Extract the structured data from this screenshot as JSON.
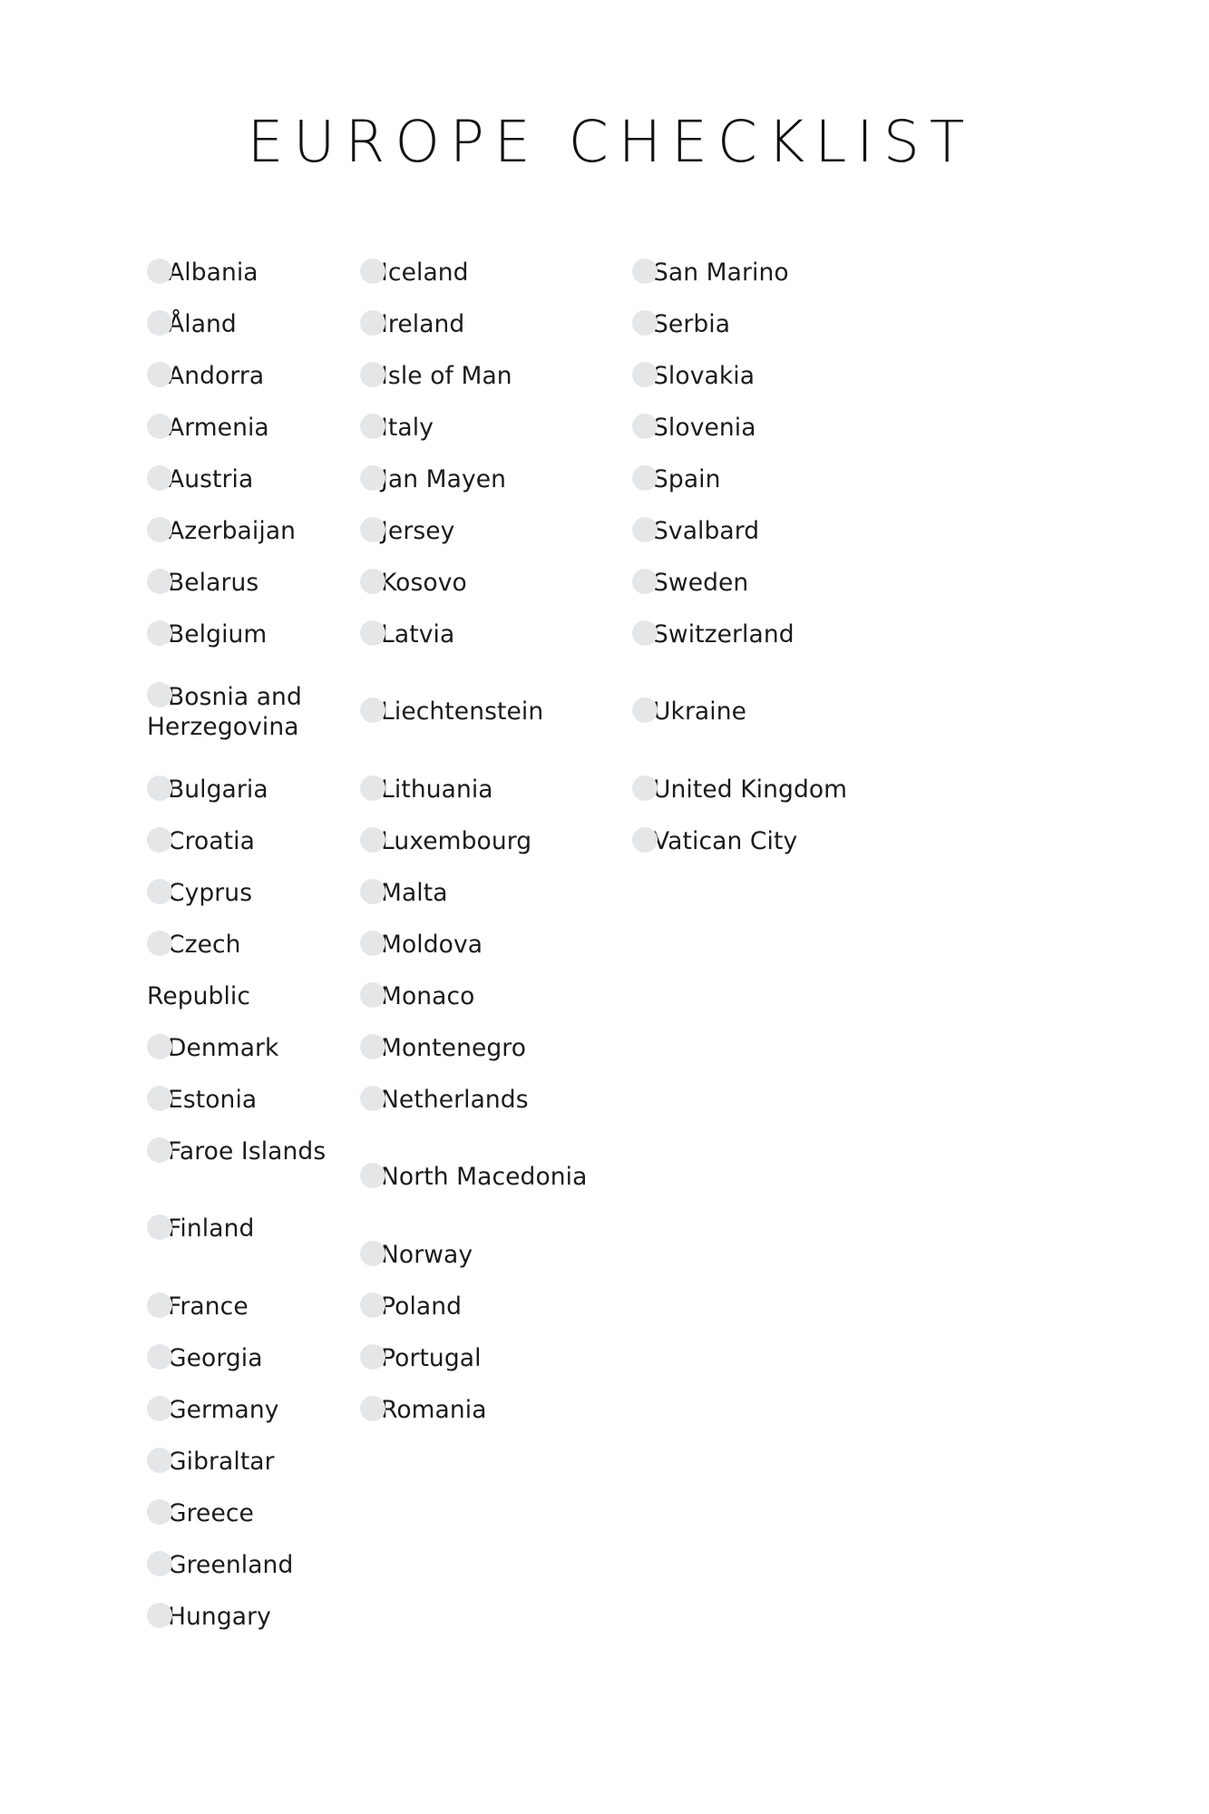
{
  "document": {
    "title": "EUROPE CHECKLIST",
    "bullet_color": "#e5e6e8",
    "text_color": "#1b1b1b",
    "background_color": "#ffffff"
  },
  "columns": [
    {
      "name": "column-1",
      "items": [
        {
          "label": "Albania",
          "tall": false
        },
        {
          "label": "Åland",
          "tall": false
        },
        {
          "label": "Andorra",
          "tall": false
        },
        {
          "label": "Armenia",
          "tall": false
        },
        {
          "label": "Austria",
          "tall": false
        },
        {
          "label": "Azerbaijan",
          "tall": false
        },
        {
          "label": "Belarus",
          "tall": false
        },
        {
          "label": "Belgium",
          "tall": false
        },
        {
          "label": "Bosnia and Herzegovina",
          "tall": true
        },
        {
          "label": "Bulgaria",
          "tall": false
        },
        {
          "label": "Croatia",
          "tall": false
        },
        {
          "label": "Cyprus",
          "tall": false
        },
        {
          "label": "Czech Republic",
          "tall": false
        },
        {
          "label": "Denmark",
          "tall": false
        },
        {
          "label": "Estonia",
          "tall": false
        },
        {
          "label": "Faroe Islands",
          "tall": false
        },
        {
          "label": "Finland",
          "tall": true
        },
        {
          "label": "France",
          "tall": false
        },
        {
          "label": "Georgia",
          "tall": false
        },
        {
          "label": "Germany",
          "tall": false
        },
        {
          "label": "Gibraltar",
          "tall": false
        },
        {
          "label": "Greece",
          "tall": false
        },
        {
          "label": "Greenland",
          "tall": false
        },
        {
          "label": "Hungary",
          "tall": false
        }
      ]
    },
    {
      "name": "column-2",
      "items": [
        {
          "label": "Iceland",
          "tall": false
        },
        {
          "label": "Ireland",
          "tall": false
        },
        {
          "label": "Isle of Man",
          "tall": false
        },
        {
          "label": "Italy",
          "tall": false
        },
        {
          "label": "Jan Mayen",
          "tall": false
        },
        {
          "label": "Jersey",
          "tall": false
        },
        {
          "label": "Kosovo",
          "tall": false
        },
        {
          "label": "Latvia",
          "tall": false
        },
        {
          "label": "Liechtenstein",
          "tall": true
        },
        {
          "label": "Lithuania",
          "tall": false
        },
        {
          "label": "Luxembourg",
          "tall": false
        },
        {
          "label": "Malta",
          "tall": false
        },
        {
          "label": "Moldova",
          "tall": false
        },
        {
          "label": "Monaco",
          "tall": false
        },
        {
          "label": "Montenegro",
          "tall": false
        },
        {
          "label": "Netherlands",
          "tall": false
        },
        {
          "label": "North Macedonia",
          "tall": true
        },
        {
          "label": "Norway",
          "tall": false
        },
        {
          "label": "Poland",
          "tall": false
        },
        {
          "label": "Portugal",
          "tall": false
        },
        {
          "label": "Romania",
          "tall": false
        }
      ]
    },
    {
      "name": "column-3",
      "items": [
        {
          "label": "San Marino",
          "tall": false
        },
        {
          "label": "Serbia",
          "tall": false
        },
        {
          "label": "Slovakia",
          "tall": false
        },
        {
          "label": "Slovenia",
          "tall": false
        },
        {
          "label": "Spain",
          "tall": false
        },
        {
          "label": "Svalbard",
          "tall": false
        },
        {
          "label": "Sweden",
          "tall": false
        },
        {
          "label": "Switzerland",
          "tall": false
        },
        {
          "label": "Ukraine",
          "tall": true
        },
        {
          "label": "United Kingdom",
          "tall": false
        },
        {
          "label": "Vatican City",
          "tall": false
        }
      ]
    }
  ]
}
